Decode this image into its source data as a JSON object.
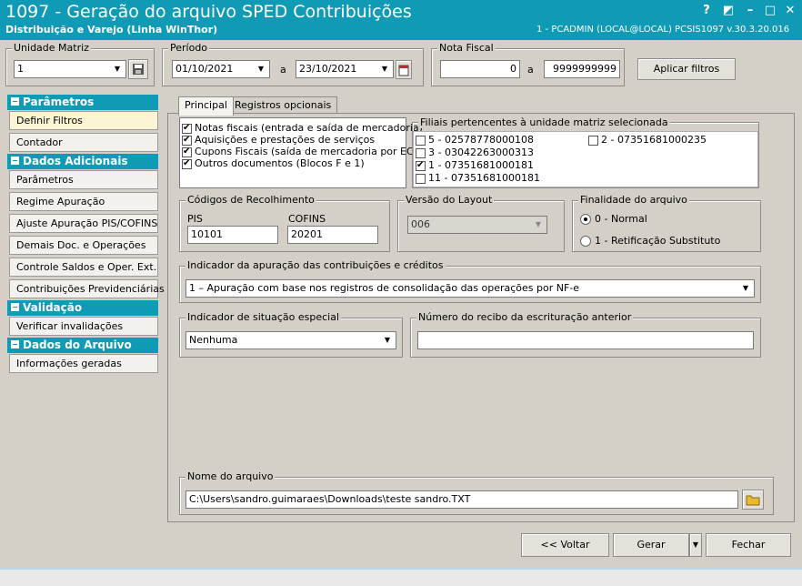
{
  "window": {
    "title": "1097 - Geração do arquivo SPED Contribuições",
    "subtitle": "Distribuição e Varejo (Linha WinThor)",
    "user_info": "1 - PCADMIN (LOCAL@LOCAL)   PCSIS1097  v.30.3.20.016",
    "help_glyph": "?",
    "restore_glyph": "◩",
    "minimize_glyph": "–",
    "maximize_glyph": "□",
    "close_glyph": "✕"
  },
  "filters": {
    "unidade_label": "Unidade Matriz",
    "unidade_value": "1",
    "periodo_label": "Período",
    "periodo_from": "01/10/2021",
    "periodo_sep": "a",
    "periodo_to": "23/10/2021",
    "nota_label": "Nota Fiscal",
    "nota_from": "0",
    "nota_sep": "a",
    "nota_to": "9999999999",
    "apply_label": "Aplicar filtros"
  },
  "sidebar": {
    "sections": [
      {
        "header": "Parâmetros",
        "items": [
          "Definir Filtros",
          "Contador"
        ]
      },
      {
        "header": "Dados Adicionais",
        "items": [
          "Parâmetros",
          "Regime Apuração",
          "Ajuste Apuração PIS/COFINS",
          "Demais Doc. e Operações",
          "Controle Saldos e Oper. Ext.",
          "Contribuições Previdenciárias"
        ]
      },
      {
        "header": "Validação",
        "items": [
          "Verificar invalidações"
        ]
      },
      {
        "header": "Dados do Arquivo",
        "items": [
          "Informações geradas"
        ]
      }
    ]
  },
  "tabs": [
    "Principal",
    "Registros opcionais"
  ],
  "documents": {
    "items": [
      {
        "label": "Notas fiscais (entrada e saída de mercadoria)",
        "checked": true
      },
      {
        "label": "Aquisições e prestações de serviços",
        "checked": true
      },
      {
        "label": "Cupons Fiscais (saída de mercadoria por ECF)",
        "checked": true
      },
      {
        "label": "Outros documentos (Blocos F e 1)",
        "checked": true
      }
    ]
  },
  "filiais": {
    "label": "Filiais pertencentes à unidade matriz selecionada",
    "col1": [
      {
        "label": "5 - 02578778000108",
        "checked": false
      },
      {
        "label": "3 - 03042263000313",
        "checked": false
      },
      {
        "label": "1 - 07351681000181",
        "checked": true
      },
      {
        "label": "11 - 07351681000181",
        "checked": false
      }
    ],
    "col2": [
      {
        "label": "2 - 07351681000235",
        "checked": false
      }
    ]
  },
  "codigos": {
    "label": "Códigos de Recolhimento",
    "pis_label": "PIS",
    "pis_value": "10101",
    "cofins_label": "COFINS",
    "cofins_value": "20201"
  },
  "layout": {
    "label": "Versão do Layout",
    "value": "006"
  },
  "finalidade": {
    "label": "Finalidade do arquivo",
    "options": [
      {
        "label": "0 - Normal",
        "selected": true
      },
      {
        "label": "1 - Retificação Substituto",
        "selected": false
      }
    ]
  },
  "indicador_apuracao": {
    "label": "Indicador da apuração das contribuições e créditos",
    "value": "1 – Apuração com base nos registros de consolidação das operações por NF-e"
  },
  "indicador_situacao": {
    "label": "Indicador de situação especial",
    "value": "Nenhuma"
  },
  "recibo": {
    "label": "Número do recibo da escrituração anterior",
    "value": ""
  },
  "arquivo": {
    "label": "Nome do arquivo",
    "value": "C:\\Users\\sandro.guimaraes\\Downloads\\teste sandro.TXT"
  },
  "footer": {
    "voltar_label": "<< Voltar",
    "gerar_label": "Gerar",
    "fechar_label": "Fechar"
  }
}
